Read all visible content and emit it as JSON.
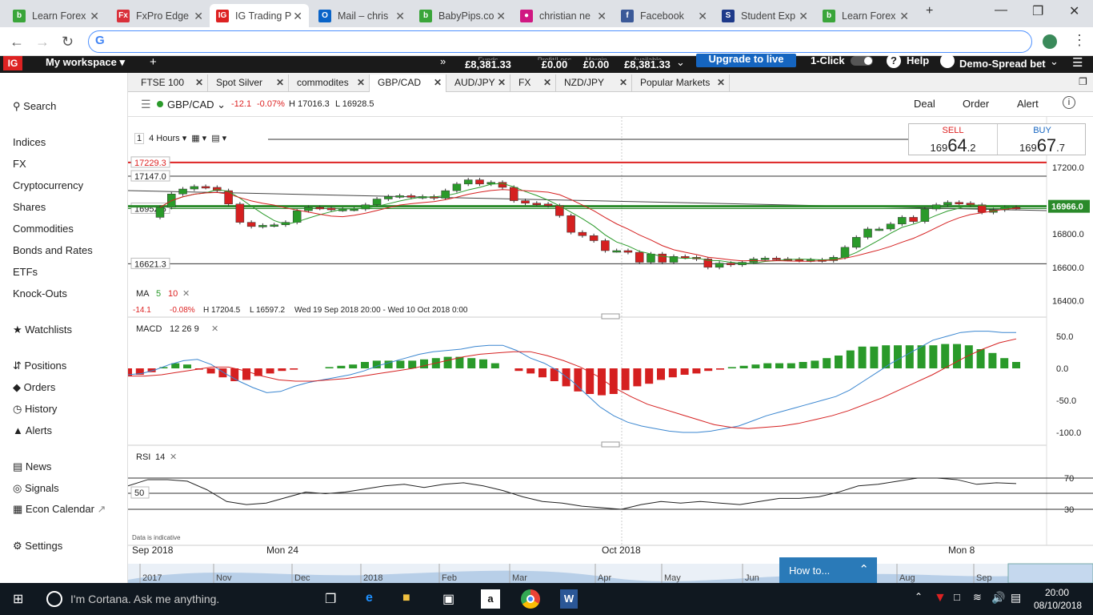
{
  "browser": {
    "tabs": [
      {
        "label": "Learn Forex",
        "icon": "babypips-icon",
        "color": "#3aa53a",
        "glyph": "b"
      },
      {
        "label": "FxPro Edge",
        "icon": "fxpro-icon",
        "color": "#d9303a",
        "glyph": "Fx"
      },
      {
        "label": "IG Trading P",
        "icon": "ig-icon",
        "color": "#d22",
        "glyph": "IG",
        "active": true
      },
      {
        "label": "Mail – chris",
        "icon": "outlook-icon",
        "color": "#0a64c8",
        "glyph": "O"
      },
      {
        "label": "BabyPips.co",
        "icon": "babypips-icon",
        "color": "#3aa53a",
        "glyph": "b"
      },
      {
        "label": "christian ne",
        "icon": "flickr-icon",
        "color": "#d01882",
        "glyph": "●"
      },
      {
        "label": "Facebook",
        "icon": "facebook-icon",
        "color": "#3b5998",
        "glyph": "f"
      },
      {
        "label": "Student Exp",
        "icon": "student-icon",
        "color": "#1e3a8a",
        "glyph": "S"
      },
      {
        "label": "Learn Forex",
        "icon": "babypips-icon",
        "color": "#3aa53a",
        "glyph": "b"
      }
    ],
    "address": ""
  },
  "topbar": {
    "workspace": "My workspace",
    "accounts": [
      {
        "caption": "Funds",
        "value": "£8,381.33"
      },
      {
        "caption": "Profit/Loss",
        "value": "£0.00"
      },
      {
        "caption": "Margin",
        "value": "£0.00"
      },
      {
        "caption": "Available",
        "value": "£8,381.33"
      }
    ],
    "upgrade": "Upgrade to live",
    "oneclick": "1-Click",
    "help": "Help",
    "account": "Demo-Spread bet"
  },
  "sidebar": {
    "search": "Search",
    "markets": [
      "Indices",
      "FX",
      "Cryptocurrency",
      "Shares",
      "Commodities",
      "Bonds and Rates",
      "ETFs",
      "Knock-Outs"
    ],
    "watchlists": "Watchlists",
    "trading": [
      "Positions",
      "Orders",
      "History",
      "Alerts"
    ],
    "info": [
      "News",
      "Signals",
      "Econ Calendar"
    ],
    "settings": "Settings"
  },
  "instrument_tabs": [
    "FTSE 100",
    "Spot Silver",
    "commodites",
    "GBP/CAD",
    "AUD/JPY",
    "FX",
    "NZD/JPY",
    "Popular Markets"
  ],
  "header": {
    "instrument": "GBP/CAD",
    "change": "-12.1",
    "change_pct": "-0.07%",
    "high": "H 17016.3",
    "low": "L 16928.5",
    "deal": "Deal",
    "order": "Order",
    "alert": "Alert"
  },
  "deal_ticket": {
    "sell_label": "SELL",
    "sell_big": "169",
    "sell_main": "64",
    "sell_dec": ".2",
    "buy_label": "BUY",
    "buy_big": "169",
    "buy_main": "67",
    "buy_dec": ".7"
  },
  "chart_toolbar": {
    "timeframe": "4 Hours"
  },
  "price_panel": {
    "levels": [
      {
        "value": "17229.3",
        "color": "#d22"
      },
      {
        "value": "17147.0",
        "color": "#333"
      },
      {
        "value": "16952.5",
        "color": "#2a8a2a"
      },
      {
        "value": "16621.3",
        "color": "#333"
      }
    ],
    "yticks": [
      "17200.0",
      "16800.0",
      "16600.0",
      "16400.0"
    ],
    "current": "16966.0",
    "ma_label": "MA",
    "ma_fast": "5",
    "ma_slow": "10",
    "info": {
      "change": "-14.1",
      "pct": "-0.08%",
      "high": "H 17204.5",
      "low": "L 16597.2",
      "range": "Wed 19 Sep 2018 20:00 - Wed 10 Oct 2018 0:00"
    }
  },
  "macd_panel": {
    "label": "MACD",
    "params": "12  26  9",
    "yticks": [
      "50.0",
      "0.0",
      "-50.0",
      "-100.0"
    ]
  },
  "rsi_panel": {
    "label": "RSI",
    "param": "14",
    "yticks": [
      "70",
      "30"
    ],
    "mid": "50"
  },
  "xaxis": {
    "labels": [
      "Sep 2018",
      "Mon 24",
      "Oct 2018",
      "Mon 8"
    ]
  },
  "navigator": {
    "labels": [
      "2017",
      "Nov",
      "Dec",
      "2018",
      "Feb",
      "Mar",
      "Apr",
      "May",
      "Jun",
      "Aug",
      "Sep"
    ]
  },
  "disclaimer": "Data is indicative",
  "howto": "How to...",
  "taskbar": {
    "cortana": "I'm Cortana. Ask me anything.",
    "time": "20:00",
    "date": "08/10/2018"
  },
  "chart_data": {
    "type": "candlestick",
    "title": "GBP/CAD 4 Hours",
    "ylim": [
      16350,
      17300
    ],
    "candles": [
      {
        "o": 16900,
        "c": 16960
      },
      {
        "o": 16960,
        "c": 17040
      },
      {
        "o": 17040,
        "c": 17070
      },
      {
        "o": 17070,
        "c": 17085
      },
      {
        "o": 17085,
        "c": 17080
      },
      {
        "o": 17080,
        "c": 17060
      },
      {
        "o": 17060,
        "c": 16980
      },
      {
        "o": 16980,
        "c": 16870
      },
      {
        "o": 16870,
        "c": 16845
      },
      {
        "o": 16845,
        "c": 16852
      },
      {
        "o": 16852,
        "c": 16855
      },
      {
        "o": 16855,
        "c": 16870
      },
      {
        "o": 16870,
        "c": 16940
      },
      {
        "o": 16940,
        "c": 16960
      },
      {
        "o": 16960,
        "c": 16955
      },
      {
        "o": 16955,
        "c": 16945
      },
      {
        "o": 16945,
        "c": 16948
      },
      {
        "o": 16948,
        "c": 16950
      },
      {
        "o": 16950,
        "c": 16975
      },
      {
        "o": 16975,
        "c": 17010
      },
      {
        "o": 17010,
        "c": 17025
      },
      {
        "o": 17025,
        "c": 17030
      },
      {
        "o": 17030,
        "c": 17020
      },
      {
        "o": 17020,
        "c": 17025
      },
      {
        "o": 17025,
        "c": 17015
      },
      {
        "o": 17015,
        "c": 17060
      },
      {
        "o": 17060,
        "c": 17100
      },
      {
        "o": 17100,
        "c": 17125
      },
      {
        "o": 17125,
        "c": 17100
      },
      {
        "o": 17100,
        "c": 17110
      },
      {
        "o": 17110,
        "c": 17080
      },
      {
        "o": 17080,
        "c": 17000
      },
      {
        "o": 17000,
        "c": 16985
      },
      {
        "o": 16985,
        "c": 16980
      },
      {
        "o": 16980,
        "c": 16970
      },
      {
        "o": 16970,
        "c": 16910
      },
      {
        "o": 16910,
        "c": 16810
      },
      {
        "o": 16810,
        "c": 16790
      },
      {
        "o": 16790,
        "c": 16760
      },
      {
        "o": 16760,
        "c": 16700
      },
      {
        "o": 16700,
        "c": 16700
      },
      {
        "o": 16700,
        "c": 16690
      },
      {
        "o": 16690,
        "c": 16630
      },
      {
        "o": 16630,
        "c": 16680
      },
      {
        "o": 16680,
        "c": 16630
      },
      {
        "o": 16630,
        "c": 16665
      },
      {
        "o": 16665,
        "c": 16660
      },
      {
        "o": 16660,
        "c": 16650
      },
      {
        "o": 16650,
        "c": 16600
      },
      {
        "o": 16600,
        "c": 16625
      },
      {
        "o": 16625,
        "c": 16615
      },
      {
        "o": 16615,
        "c": 16630
      },
      {
        "o": 16630,
        "c": 16650
      },
      {
        "o": 16650,
        "c": 16655
      },
      {
        "o": 16655,
        "c": 16650
      },
      {
        "o": 16650,
        "c": 16648
      },
      {
        "o": 16648,
        "c": 16642
      },
      {
        "o": 16642,
        "c": 16645
      },
      {
        "o": 16645,
        "c": 16640
      },
      {
        "o": 16640,
        "c": 16660
      },
      {
        "o": 16660,
        "c": 16720
      },
      {
        "o": 16720,
        "c": 16780
      },
      {
        "o": 16780,
        "c": 16830
      },
      {
        "o": 16830,
        "c": 16830
      },
      {
        "o": 16830,
        "c": 16860
      },
      {
        "o": 16860,
        "c": 16900
      },
      {
        "o": 16900,
        "c": 16875
      },
      {
        "o": 16875,
        "c": 16950
      },
      {
        "o": 16950,
        "c": 16975
      },
      {
        "o": 16975,
        "c": 16990
      },
      {
        "o": 16990,
        "c": 16985
      },
      {
        "o": 16985,
        "c": 16975
      },
      {
        "o": 16975,
        "c": 16930
      },
      {
        "o": 16930,
        "c": 16945
      },
      {
        "o": 16945,
        "c": 16960
      },
      {
        "o": 16960,
        "c": 16958
      }
    ],
    "macd_hist": [
      -12,
      -10,
      -6,
      2,
      8,
      6,
      -2,
      -8,
      -14,
      -20,
      -18,
      -12,
      -8,
      -4,
      -2,
      0,
      0,
      2,
      4,
      6,
      10,
      12,
      12,
      12,
      12,
      14,
      16,
      18,
      18,
      16,
      14,
      8,
      0,
      -4,
      -8,
      -14,
      -20,
      -28,
      -36,
      -40,
      -42,
      -40,
      -34,
      -28,
      -24,
      -18,
      -14,
      -10,
      -8,
      -4,
      -2,
      2,
      4,
      6,
      8,
      8,
      8,
      10,
      12,
      16,
      20,
      28,
      34,
      34,
      36,
      36,
      36,
      36,
      36,
      38,
      38,
      36,
      30,
      24,
      16,
      10
    ],
    "macd_line": [
      -10,
      -8,
      -2,
      6,
      12,
      14,
      6,
      -8,
      -20,
      -30,
      -38,
      -36,
      -28,
      -22,
      -18,
      -14,
      -10,
      -4,
      4,
      10,
      16,
      22,
      26,
      28,
      30,
      34,
      36,
      36,
      28,
      16,
      8,
      -4,
      -20,
      -40,
      -60,
      -74,
      -84,
      -90,
      -94,
      -98,
      -100,
      -100,
      -98,
      -94,
      -90,
      -82,
      -74,
      -68,
      -62,
      -56,
      -50,
      -44,
      -34,
      -20,
      -6,
      8,
      20,
      32,
      44,
      50,
      56,
      58,
      58,
      56,
      56
    ],
    "signal_line": [
      -12,
      -12,
      -10,
      -6,
      -2,
      2,
      2,
      -4,
      -12,
      -18,
      -20,
      -20,
      -18,
      -16,
      -12,
      -8,
      -4,
      0,
      6,
      12,
      18,
      22,
      24,
      26,
      26,
      20,
      12,
      2,
      -12,
      -30,
      -44,
      -56,
      -64,
      -72,
      -80,
      -88,
      -92,
      -94,
      -92,
      -90,
      -86,
      -80,
      -74,
      -66,
      -56,
      -46,
      -34,
      -22,
      -10,
      4,
      18,
      30,
      40,
      46
    ],
    "rsi": [
      60,
      68,
      68,
      66,
      55,
      40,
      36,
      38,
      45,
      52,
      50,
      52,
      56,
      60,
      62,
      58,
      62,
      64,
      60,
      54,
      46,
      40,
      38,
      34,
      32,
      30,
      36,
      40,
      38,
      40,
      38,
      36,
      40,
      44,
      44,
      46,
      52,
      60,
      62,
      66,
      70,
      70,
      68,
      62,
      64,
      63
    ]
  }
}
